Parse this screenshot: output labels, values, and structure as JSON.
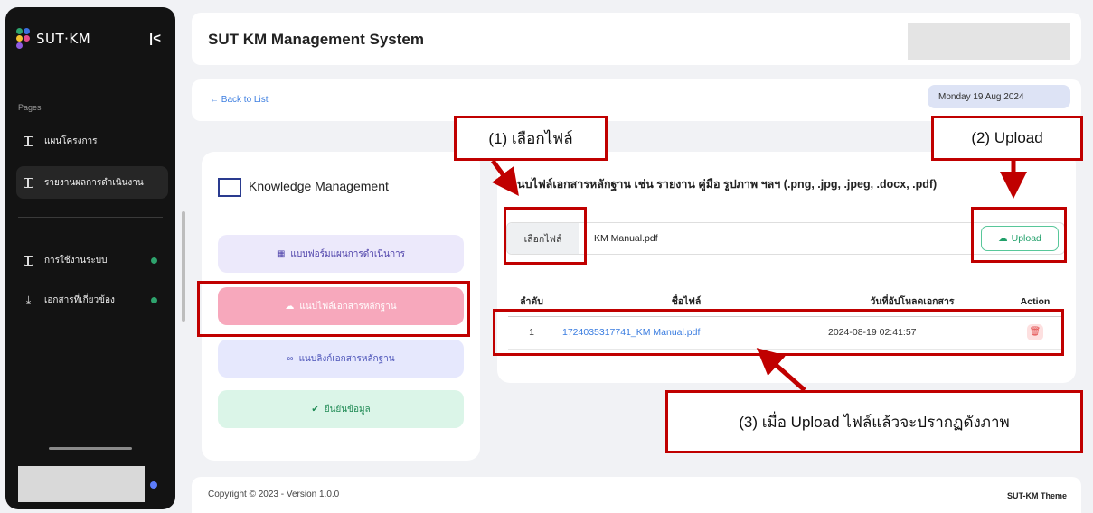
{
  "sidebar": {
    "logo_text": "SUT·KM",
    "collapse_glyph": "|<",
    "pages_label": "Pages",
    "items": [
      {
        "label": "แผนโครงการ",
        "icon": "layout-icon"
      },
      {
        "label": "รายงานผลการดำเนินงาน",
        "icon": "report-icon"
      },
      {
        "label": "การใช้งานระบบ",
        "icon": "book-icon"
      },
      {
        "label": "เอกสารที่เกี่ยวข้อง",
        "icon": "download-icon"
      }
    ],
    "colors": {
      "background": "#131313",
      "status_dot": "#2ea36d"
    }
  },
  "header": {
    "title": "SUT KM Management System"
  },
  "backbar": {
    "back_link": "← Back to List",
    "date": "Monday 19 Aug 2024"
  },
  "left_card": {
    "title": "Knowledge Management",
    "buttons": [
      {
        "label": "แบบฟอร์มแผนการดำเนินการ",
        "icon": "form-icon"
      },
      {
        "label": "แนบไฟล์เอกสารหลักฐาน",
        "icon": "cloud-upload-icon"
      },
      {
        "label": "แนบลิงก์เอกสารหลักฐาน",
        "icon": "link-icon"
      },
      {
        "label": "ยืนยันข้อมูล",
        "icon": "check-circle-icon"
      }
    ]
  },
  "upload": {
    "instruction": "แนบไฟล์เอกสารหลักฐาน เช่น รายงาน คู่มือ รูปภาพ ฯลฯ (.png, .jpg, .jpeg, .docx, .pdf)",
    "choose_button": "เลือกไฟล์",
    "file_name": "KM Manual.pdf",
    "upload_button": "Upload"
  },
  "table": {
    "headers": [
      "ลำดับ",
      "ชื่อไฟล์",
      "วันที่อัปโหลดเอกสาร",
      "Action"
    ],
    "rows": [
      {
        "no": "1",
        "file": "1724035317741_KM Manual.pdf",
        "date": "2024-08-19 02:41:57"
      }
    ]
  },
  "footer": {
    "copyright": "Copyright © 2023 - Version 1.0.0",
    "theme": "SUT-KM Theme"
  },
  "annotations": {
    "step1": "(1) เลือกไฟล์",
    "step2": "(2) Upload",
    "step3": "(3) เมื่อ Upload ไฟล์แล้วจะปรากฏดังภาพ",
    "color": "#c00000"
  }
}
